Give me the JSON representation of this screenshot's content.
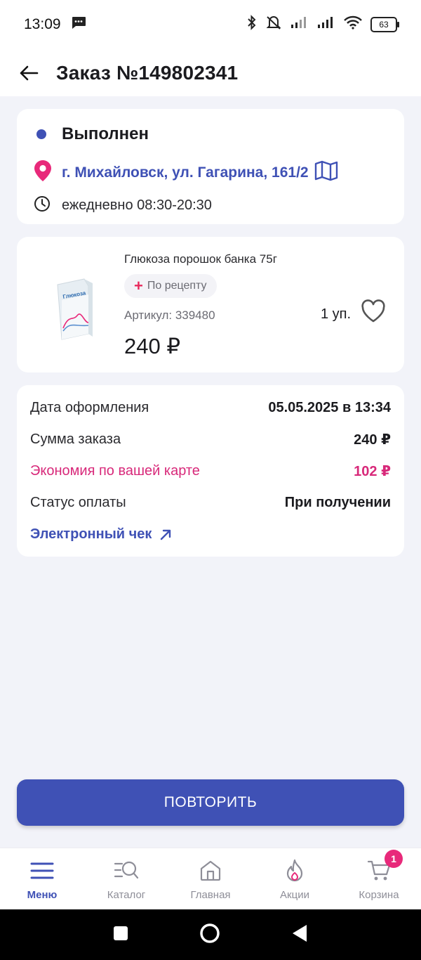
{
  "status_bar": {
    "time": "13:09",
    "battery": "63"
  },
  "header": {
    "title": "Заказ №149802341"
  },
  "order_status": {
    "status": "Выполнен",
    "address": "г. Михайловск, ул. Гагарина, 161/2",
    "hours": "ежедневно 08:30-20:30"
  },
  "product": {
    "name": "Глюкоза порошок банка 75г",
    "package_label": "Глюкоза",
    "rx_label": "По рецепту",
    "article": "Артикул: 339480",
    "quantity": "1 уп.",
    "price": "240 ₽"
  },
  "details": {
    "date_label": "Дата оформления",
    "date_value": "05.05.2025 в 13:34",
    "sum_label": "Сумма заказа",
    "sum_value": "240 ₽",
    "savings_label": "Экономия по вашей карте",
    "savings_value": "102 ₽",
    "payment_label": "Статус оплаты",
    "payment_value": "При получении",
    "receipt_link": "Электронный чек"
  },
  "repeat_button": "ПОВТОРИТЬ",
  "bottom_nav": {
    "items": [
      {
        "label": "Меню",
        "icon": "menu-icon",
        "active": true
      },
      {
        "label": "Каталог",
        "icon": "catalog-search-icon"
      },
      {
        "label": "Главная",
        "icon": "home-icon"
      },
      {
        "label": "Акции",
        "icon": "flame-icon"
      },
      {
        "label": "Корзина",
        "icon": "cart-icon",
        "badge": "1"
      }
    ]
  },
  "colors": {
    "accent": "#3F51B5",
    "pink": "#E8297A",
    "savings": "#D8297A",
    "background": "#F2F3F9"
  }
}
